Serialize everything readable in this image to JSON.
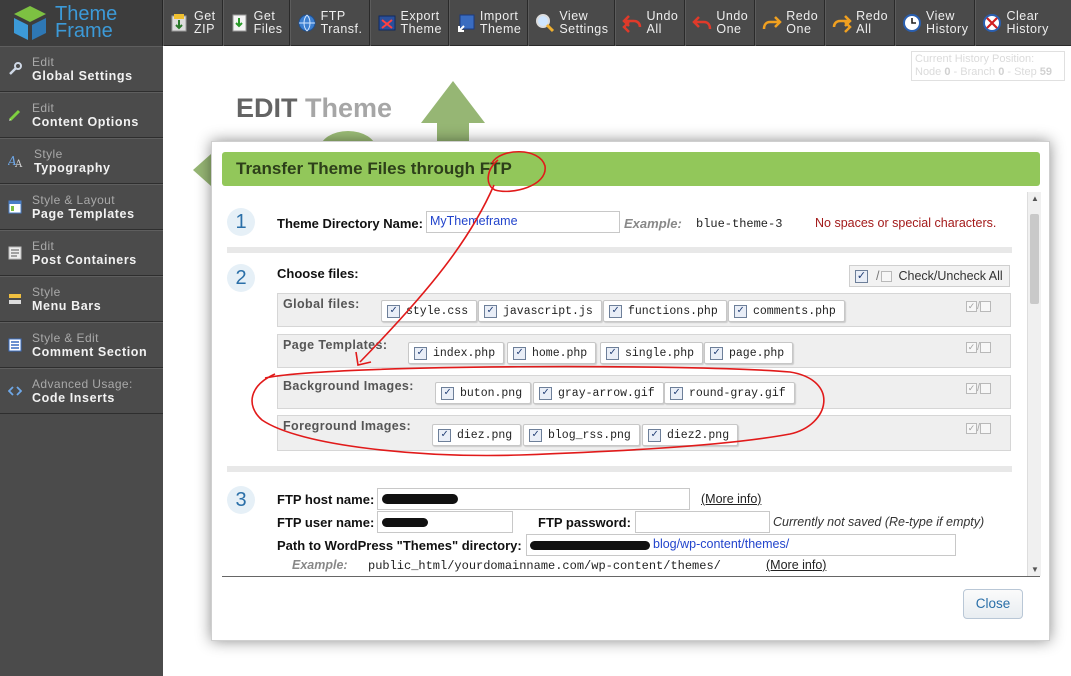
{
  "logo": {
    "line1": "Theme",
    "line2": "Frame"
  },
  "toolbar": [
    {
      "id": "get-zip",
      "label": "Get\nZIP",
      "icon": "download-zip-icon"
    },
    {
      "id": "get-files",
      "label": "Get\nFiles",
      "icon": "download-files-icon"
    },
    {
      "id": "ftp-transfer",
      "label": "FTP\nTransf.",
      "icon": "ftp-globe-icon"
    },
    {
      "id": "export-theme",
      "label": "Export\nTheme",
      "icon": "export-icon"
    },
    {
      "id": "import-theme",
      "label": "Import\nTheme",
      "icon": "import-icon"
    },
    {
      "id": "view-settings",
      "label": "View\nSettings",
      "icon": "magnifier-icon"
    },
    {
      "id": "undo-all",
      "label": "Undo\nAll",
      "icon": "undo-all-icon"
    },
    {
      "id": "undo-one",
      "label": "Undo\nOne",
      "icon": "undo-icon"
    },
    {
      "id": "redo-one",
      "label": "Redo\nOne",
      "icon": "redo-icon"
    },
    {
      "id": "redo-all",
      "label": "Redo\nAll",
      "icon": "redo-all-icon"
    },
    {
      "id": "view-history",
      "label": "View\nHistory",
      "icon": "clock-icon"
    },
    {
      "id": "clear-history",
      "label": "Clear\nHistory",
      "icon": "clear-history-icon"
    }
  ],
  "sidebar": [
    {
      "small": "Edit",
      "big": "Global Settings",
      "icon": "wrench-icon"
    },
    {
      "small": "Edit",
      "big": "Content Options",
      "icon": "pencil-icon"
    },
    {
      "small": "Style",
      "big": "Typography",
      "icon": "typography-icon"
    },
    {
      "small": "Style & Layout",
      "big": "Page Templates",
      "icon": "template-icon"
    },
    {
      "small": "Edit",
      "big": "Post Containers",
      "icon": "post-container-icon"
    },
    {
      "small": "Style",
      "big": "Menu Bars",
      "icon": "menu-bars-icon"
    },
    {
      "small": "Style & Edit",
      "big": "Comment Section",
      "icon": "comment-section-icon"
    },
    {
      "small": "Advanced Usage:",
      "big": "Code Inserts",
      "icon": "code-icon"
    }
  ],
  "page": {
    "title_part1": "EDIT",
    "title_part2": "Theme"
  },
  "history": {
    "label": "Current History Position:",
    "node_label": "Node",
    "node": "0",
    "branch_label": "Branch",
    "branch": "0",
    "step_label": "Step",
    "step": "59"
  },
  "modal": {
    "title": "Transfer Theme Files through FTP",
    "close_label": "Close",
    "step1": {
      "number": "1",
      "label": "Theme Directory Name",
      "value": "MyThemeframe",
      "example_label": "Example:",
      "example_value": "blue-theme-3",
      "warning": "No spaces or special characters."
    },
    "step2": {
      "number": "2",
      "label": "Choose files:",
      "check_all_label": "Check/Uncheck All",
      "groups": [
        {
          "title": "Global files:",
          "files": [
            "style.css",
            "javascript.js",
            "functions.php",
            "comments.php"
          ]
        },
        {
          "title": "Page Templates:",
          "files": [
            "index.php",
            "home.php",
            "single.php",
            "page.php"
          ]
        },
        {
          "title": "Background Images:",
          "files": [
            "buton.png",
            "gray-arrow.gif",
            "round-gray.gif"
          ]
        },
        {
          "title": "Foreground Images:",
          "files": [
            "diez.png",
            "blog_rss.png",
            "diez2.png"
          ]
        }
      ]
    },
    "step3": {
      "number": "3",
      "host_label": "FTP host name:",
      "host_value": "",
      "more_info": "(More info)",
      "user_label": "FTP user name:",
      "user_value": "",
      "password_label": "FTP password:",
      "password_note": "Currently not saved (Re-type if empty)",
      "path_label": "Path to WordPress \"Themes\" directory:",
      "path_value_suffix": "blog/wp-content/themes/",
      "example_label": "Example:",
      "example_value": "public_html/yourdomainname.com/wp-content/themes/",
      "more_info2": "(More info)"
    }
  },
  "colors": {
    "header_green": "#92c75a",
    "annotation_red": "#e11a1a",
    "logo_blue": "#3c9ad8",
    "sidebar_bg": "#4b4b4b"
  }
}
